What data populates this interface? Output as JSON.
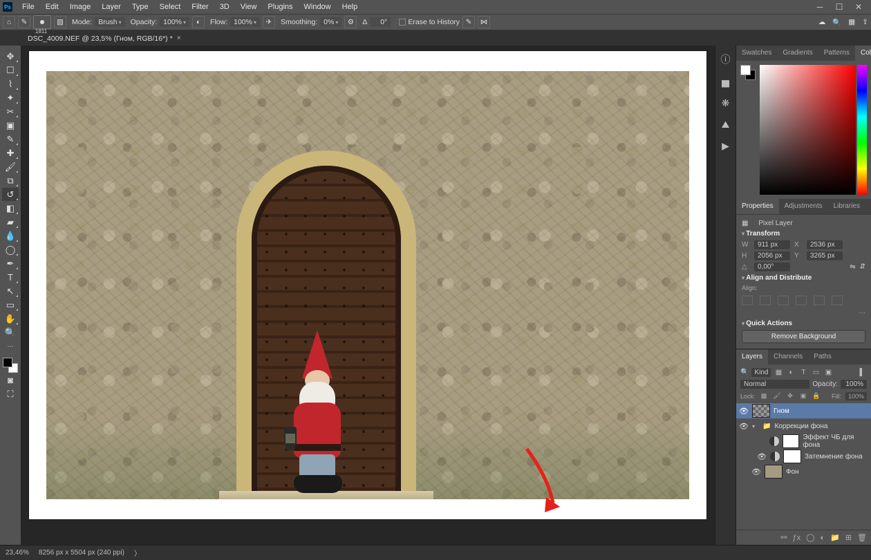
{
  "menu": {
    "items": [
      "File",
      "Edit",
      "Image",
      "Layer",
      "Type",
      "Select",
      "Filter",
      "3D",
      "View",
      "Plugins",
      "Window",
      "Help"
    ]
  },
  "options": {
    "brush_size": "1811",
    "mode_label": "Mode:",
    "mode_value": "Brush",
    "opacity_label": "Opacity:",
    "opacity_value": "100%",
    "flow_label": "Flow:",
    "flow_value": "100%",
    "smoothing_label": "Smoothing:",
    "smoothing_value": "0%",
    "angle_label": "Δ",
    "angle_value": "0°",
    "erase_label": "Erase to History"
  },
  "tab": {
    "title": "DSC_4009.NEF @ 23,5% (Гном, RGB/16*) *"
  },
  "panel_tabs": {
    "color_group": [
      "Swatches",
      "Gradients",
      "Patterns",
      "Color"
    ],
    "color_active": "Color",
    "props_group": [
      "Properties",
      "Adjustments",
      "Libraries"
    ],
    "props_active": "Properties",
    "layers_group": [
      "Layers",
      "Channels",
      "Paths"
    ],
    "layers_active": "Layers"
  },
  "properties": {
    "kind": "Pixel Layer",
    "transform_hd": "Transform",
    "W": "911 px",
    "H": "2056 px",
    "X": "2536 px",
    "Y": "3265 px",
    "angle": "0,00°",
    "align_hd": "Align and Distribute",
    "align_label": "Align:",
    "qa_hd": "Quick Actions",
    "qa_btn": "Remove Background"
  },
  "layers": {
    "kind_label": "Kind",
    "blend": "Normal",
    "opacity_label": "Opacity:",
    "opacity": "100%",
    "lock_label": "Lock:",
    "fill_label": "Fill:",
    "fill": "100%",
    "items": [
      {
        "name": "Гном",
        "sel": true,
        "eye": true,
        "type": "pixel"
      },
      {
        "name": "Коррекции фона",
        "eye": true,
        "type": "group"
      },
      {
        "name": "Эффект ЧБ для фона",
        "eye": false,
        "type": "adj",
        "indent": 2
      },
      {
        "name": "Затемнение фона",
        "eye": true,
        "type": "adj",
        "indent": 2
      },
      {
        "name": "Фон",
        "eye": true,
        "type": "bg",
        "indent": 1
      }
    ]
  },
  "status": {
    "zoom": "23,46%",
    "dims": "8256 px x 5504 px (240 ppi)"
  }
}
